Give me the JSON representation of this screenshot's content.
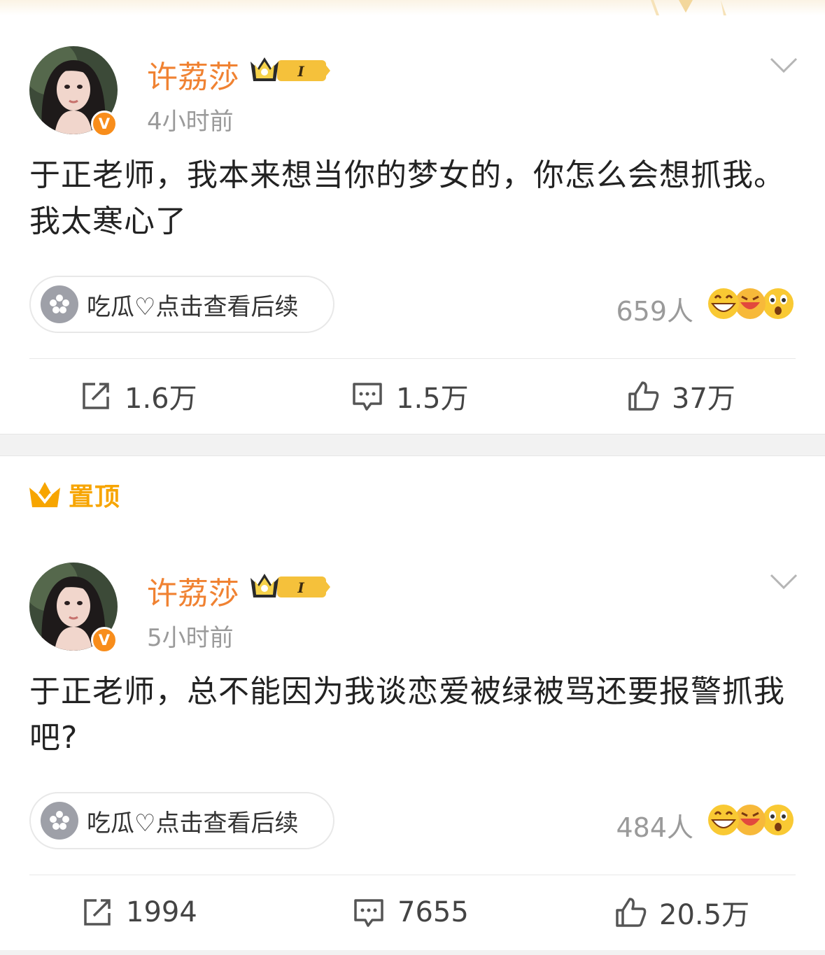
{
  "posts": [
    {
      "username": "许荔莎",
      "time": "4小时前",
      "content": "于正老师，我本来想当你的梦女的，你怎么会想抓我。我太寒心了",
      "chip_label": "吃瓜♡点击查看后续",
      "reaction_count": "659人",
      "repost_count": "1.6万",
      "comment_count": "1.5万",
      "like_count": "37万"
    },
    {
      "username": "许荔莎",
      "time": "5小时前",
      "content": "于正老师，总不能因为我谈恋爱被绿被骂还要报警抓我吧?",
      "chip_label": "吃瓜♡点击查看后续",
      "reaction_count": "484人",
      "repost_count": "1994",
      "comment_count": "7655",
      "like_count": "20.5万"
    }
  ],
  "pinned_label": "置顶",
  "badge_text": "I",
  "verify_mark": "V",
  "colors": {
    "username": "#f08232",
    "pinned": "#f7a500",
    "verify": "#f88d1b",
    "muted_text": "#9a9a9a"
  },
  "icons": [
    "repost-icon",
    "comment-icon",
    "like-icon",
    "more-chevron-icon",
    "crown-icon",
    "watermelon-icon"
  ]
}
